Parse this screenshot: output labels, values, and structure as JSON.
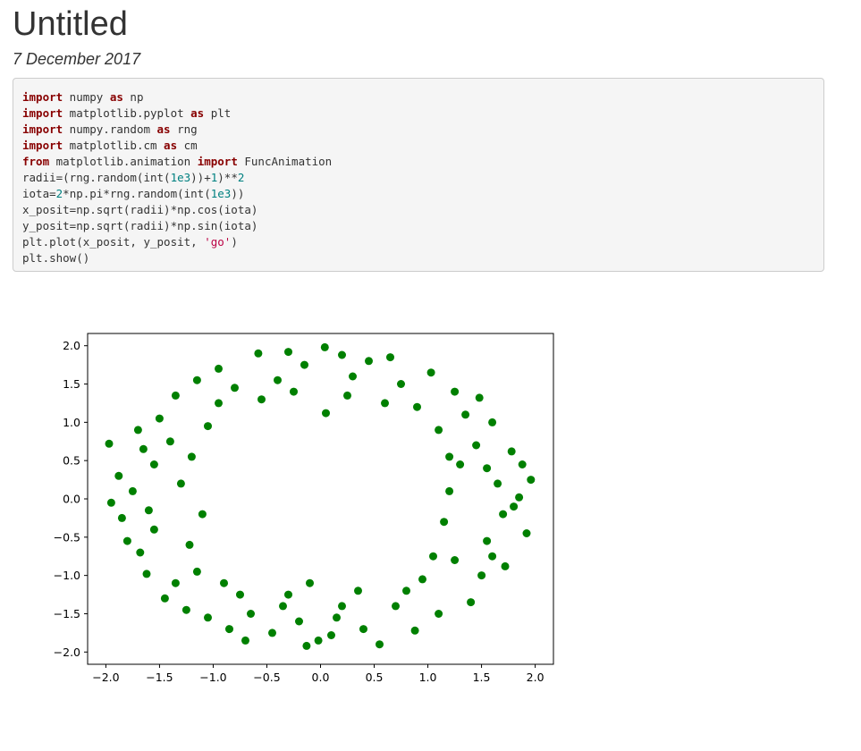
{
  "page": {
    "title": "Untitled",
    "date": "7 December 2017"
  },
  "code": {
    "lines": [
      [
        {
          "t": "import",
          "c": "kw"
        },
        {
          "t": " numpy ",
          "c": ""
        },
        {
          "t": "as",
          "c": "kw"
        },
        {
          "t": " np",
          "c": ""
        }
      ],
      [
        {
          "t": "import",
          "c": "kw"
        },
        {
          "t": " matplotlib.pyplot ",
          "c": ""
        },
        {
          "t": "as",
          "c": "kw"
        },
        {
          "t": " plt",
          "c": ""
        }
      ],
      [
        {
          "t": "import",
          "c": "kw"
        },
        {
          "t": " numpy.random ",
          "c": ""
        },
        {
          "t": "as",
          "c": "kw"
        },
        {
          "t": " rng",
          "c": ""
        }
      ],
      [
        {
          "t": "import",
          "c": "kw"
        },
        {
          "t": " matplotlib.cm ",
          "c": ""
        },
        {
          "t": "as",
          "c": "kw"
        },
        {
          "t": " cm",
          "c": ""
        }
      ],
      [
        {
          "t": "from",
          "c": "kw"
        },
        {
          "t": " matplotlib.animation ",
          "c": ""
        },
        {
          "t": "import",
          "c": "kw"
        },
        {
          "t": " FuncAnimation",
          "c": ""
        }
      ],
      [
        {
          "t": "radii=(rng.random(int(",
          "c": ""
        },
        {
          "t": "1e3",
          "c": "num"
        },
        {
          "t": "))+",
          "c": ""
        },
        {
          "t": "1",
          "c": "num"
        },
        {
          "t": ")**",
          "c": ""
        },
        {
          "t": "2",
          "c": "num"
        }
      ],
      [
        {
          "t": "iota=",
          "c": ""
        },
        {
          "t": "2",
          "c": "num"
        },
        {
          "t": "*np.pi*rng.random(int(",
          "c": ""
        },
        {
          "t": "1e3",
          "c": "num"
        },
        {
          "t": "))",
          "c": ""
        }
      ],
      [
        {
          "t": "x_posit=np.sqrt(radii)*np.cos(iota)",
          "c": ""
        }
      ],
      [
        {
          "t": "y_posit=np.sqrt(radii)*np.sin(iota)",
          "c": ""
        }
      ],
      [
        {
          "t": "plt.plot(x_posit, y_posit, ",
          "c": ""
        },
        {
          "t": "'go'",
          "c": "str"
        },
        {
          "t": ")",
          "c": ""
        }
      ],
      [
        {
          "t": "plt.show()",
          "c": ""
        }
      ]
    ]
  },
  "chart_data": {
    "type": "scatter",
    "title": "",
    "xlabel": "",
    "ylabel": "",
    "xlim": [
      -2.17,
      2.17
    ],
    "ylim": [
      -2.16,
      2.16
    ],
    "xticks": [
      -2.0,
      -1.5,
      -1.0,
      -0.5,
      0.0,
      0.5,
      1.0,
      1.5,
      2.0
    ],
    "xtick_labels": [
      "−2.0",
      "−1.5",
      "−1.0",
      "−0.5",
      "0.0",
      "0.5",
      "1.0",
      "1.5",
      "2.0"
    ],
    "yticks": [
      2.0,
      1.5,
      1.0,
      0.5,
      0.0,
      -0.5,
      -1.0,
      -1.5,
      -2.0
    ],
    "ytick_labels": [
      "2.0",
      "1.5",
      "1.0",
      "0.5",
      "0.0",
      "−0.5",
      "−1.0",
      "−1.5",
      "−2.0"
    ],
    "grid": false,
    "marker_color": "#008000",
    "series": [
      {
        "points": [
          [
            -0.13,
            -1.92
          ],
          [
            0.04,
            1.98
          ],
          [
            -1.97,
            0.72
          ],
          [
            1.96,
            0.25
          ],
          [
            -1.95,
            -0.05
          ],
          [
            1.92,
            -0.45
          ],
          [
            -0.58,
            1.9
          ],
          [
            0.55,
            -1.9
          ],
          [
            1.72,
            -0.88
          ],
          [
            -1.62,
            -0.98
          ],
          [
            1.78,
            0.62
          ],
          [
            -1.35,
            1.35
          ],
          [
            -0.95,
            1.7
          ],
          [
            1.03,
            1.65
          ],
          [
            -0.3,
            1.92
          ],
          [
            0.88,
            -1.72
          ],
          [
            -0.7,
            -1.85
          ],
          [
            1.48,
            1.32
          ],
          [
            -1.45,
            -1.3
          ],
          [
            1.4,
            -1.35
          ],
          [
            -1.88,
            0.3
          ],
          [
            1.85,
            0.02
          ],
          [
            -1.8,
            -0.55
          ],
          [
            0.2,
            1.88
          ],
          [
            -1.25,
            -1.45
          ],
          [
            -0.02,
            -1.85
          ],
          [
            0.45,
            1.8
          ],
          [
            1.6,
            1.0
          ],
          [
            -1.7,
            0.9
          ],
          [
            1.55,
            -0.55
          ],
          [
            -1.55,
            0.45
          ],
          [
            1.3,
            0.45
          ],
          [
            -1.3,
            0.2
          ],
          [
            1.15,
            -0.3
          ],
          [
            -1.1,
            -0.2
          ],
          [
            1.1,
            0.9
          ],
          [
            -1.05,
            0.95
          ],
          [
            0.95,
            -1.05
          ],
          [
            -0.9,
            -1.1
          ],
          [
            0.6,
            1.25
          ],
          [
            -0.55,
            1.3
          ],
          [
            0.35,
            -1.2
          ],
          [
            -0.3,
            -1.25
          ],
          [
            0.05,
            1.12
          ],
          [
            -0.1,
            -1.1
          ],
          [
            1.2,
            0.1
          ],
          [
            -1.22,
            -0.6
          ],
          [
            1.25,
            -0.8
          ],
          [
            -1.4,
            0.75
          ],
          [
            1.45,
            0.7
          ],
          [
            -0.8,
            1.45
          ],
          [
            0.75,
            1.5
          ],
          [
            -0.65,
            -1.5
          ],
          [
            0.7,
            -1.4
          ],
          [
            -1.6,
            -0.15
          ],
          [
            1.65,
            0.2
          ],
          [
            -1.68,
            -0.7
          ],
          [
            1.7,
            -0.2
          ],
          [
            -0.4,
            1.55
          ],
          [
            0.3,
            1.6
          ],
          [
            -0.2,
            -1.6
          ],
          [
            0.15,
            -1.55
          ],
          [
            -1.15,
            1.55
          ],
          [
            1.25,
            1.4
          ],
          [
            -1.05,
            -1.55
          ],
          [
            1.1,
            -1.5
          ],
          [
            -1.75,
            0.1
          ],
          [
            1.8,
            -0.1
          ],
          [
            -0.45,
            -1.75
          ],
          [
            0.4,
            -1.7
          ],
          [
            -1.5,
            1.05
          ],
          [
            1.5,
            -1.0
          ],
          [
            -0.15,
            1.75
          ],
          [
            0.1,
            -1.78
          ],
          [
            -1.85,
            -0.25
          ],
          [
            1.88,
            0.45
          ],
          [
            0.65,
            1.85
          ],
          [
            -0.85,
            -1.7
          ],
          [
            1.35,
            1.1
          ],
          [
            -1.35,
            -1.1
          ],
          [
            -0.95,
            1.25
          ],
          [
            0.9,
            1.2
          ],
          [
            -0.75,
            -1.25
          ],
          [
            0.8,
            -1.2
          ],
          [
            -1.2,
            0.55
          ],
          [
            1.2,
            0.55
          ],
          [
            -1.15,
            -0.95
          ],
          [
            1.05,
            -0.75
          ],
          [
            0.25,
            1.35
          ],
          [
            -0.25,
            1.4
          ],
          [
            0.2,
            -1.4
          ],
          [
            -0.35,
            -1.4
          ],
          [
            1.55,
            0.4
          ],
          [
            -1.55,
            -0.4
          ],
          [
            1.6,
            -0.75
          ],
          [
            -1.65,
            0.65
          ]
        ]
      }
    ]
  }
}
